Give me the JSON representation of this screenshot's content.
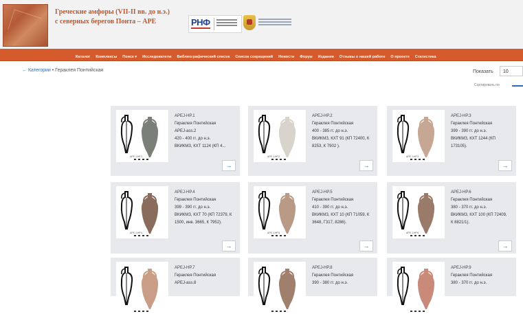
{
  "site": {
    "title_line1": "Греческие амфоры (VII-II вв. до н.э.)",
    "title_line2": "с северных берегов Понта – АРЕ",
    "partner_rnf": "РНФ"
  },
  "nav": {
    "items": [
      "Каталог",
      "Комплексы",
      "Поиск ▾",
      "Исследователи",
      "Библиографический список",
      "Список сокращений",
      "Новости",
      "Форум",
      "Издания",
      "Отзывы о нашей работе",
      "О проекте",
      "Статистика"
    ]
  },
  "breadcrumb": {
    "arrow": "←",
    "categories": "Категории",
    "separator": " • ",
    "current": "Гераклея Понтийская"
  },
  "controls": {
    "show_label": "Показать",
    "show_value": "10",
    "sort_label": "Сортировать по"
  },
  "cards": [
    {
      "code": "APEJ-HP.1",
      "city": "Гераклея Понтийская",
      "variant": "APEJ-ass.2",
      "date": "420 - 400 гг. до н.э.",
      "ref": "ВКИКМЗ, КХТ 1124 (КП 4...",
      "photo_id": "APE J-HP.1",
      "tint": "#7a8078"
    },
    {
      "code": "APEJ-HP.2",
      "city": "Гераклея Понтийская",
      "date": "400 - 385 гг. до н.э.",
      "ref": "ВКИКМЗ, КХТ 91 (КП 72400, К 8253, К 7902 ).",
      "photo_id": "APE J-HP.2",
      "tint": "#d8d4cc"
    },
    {
      "code": "APEJ-HP.3",
      "city": "Гераклея Понтийская",
      "date": "399 - 390 гг. до н.э.",
      "ref": "ВКИКМЗ, КХТ 1244 (КП 173105).",
      "photo_id": "APE J-HP.3",
      "tint": "#c6a793"
    },
    {
      "code": "APEJ-HP.4",
      "city": "Гераклея Понтийская",
      "date": "399 - 390 гг. до н.э.",
      "ref": "ВКИКМЗ, КХТ 70 (КП 72379, К 1500, инв. 3665, К 7952).",
      "photo_id": "APE J-HP.4",
      "tint": "#8a6c5c"
    },
    {
      "code": "APEJ-HP.5",
      "city": "Гераклея Понтийская",
      "date": "410 - 390 гг. до н.э.",
      "ref": "ВКИКМЗ, КХТ 10 (КП 71059, К 3648, Г317, 8286).",
      "photo_id": "APE J-HP.5",
      "tint": "#b89a86"
    },
    {
      "code": "APEJ-HP.6",
      "city": "Гераклея Понтийская",
      "date": "380 - 370 гг. до н.э.",
      "ref": "ВКИКМЗ, КХТ 100 (КП 72409, К 8821/1).",
      "photo_id": "APE J-HP.6",
      "tint": "#9a7a68"
    },
    {
      "code": "APEJ-HP.7",
      "city": "Гераклея Понтийская",
      "variant": "APEJ-ass.8",
      "date": "",
      "ref": "",
      "photo_id": "",
      "tint": "#c99d86"
    },
    {
      "code": "APEJ-HP.8",
      "city": "Гераклея Понтийская",
      "date": "390 - 380 гг. до н.э.",
      "ref": "",
      "photo_id": "",
      "tint": "#a07f6c"
    },
    {
      "code": "APEJ-HP.9",
      "city": "Гераклея Понтийская",
      "date": "380 - 370 гг. до н.э.",
      "ref": "",
      "photo_id": "",
      "tint": "#c98a7a"
    }
  ],
  "card_arrow": "→",
  "colors": {
    "nav_bg": "#d55a2c",
    "title": "#c0582d",
    "link": "#2a6db5",
    "card_bg": "#e8e9ec"
  }
}
